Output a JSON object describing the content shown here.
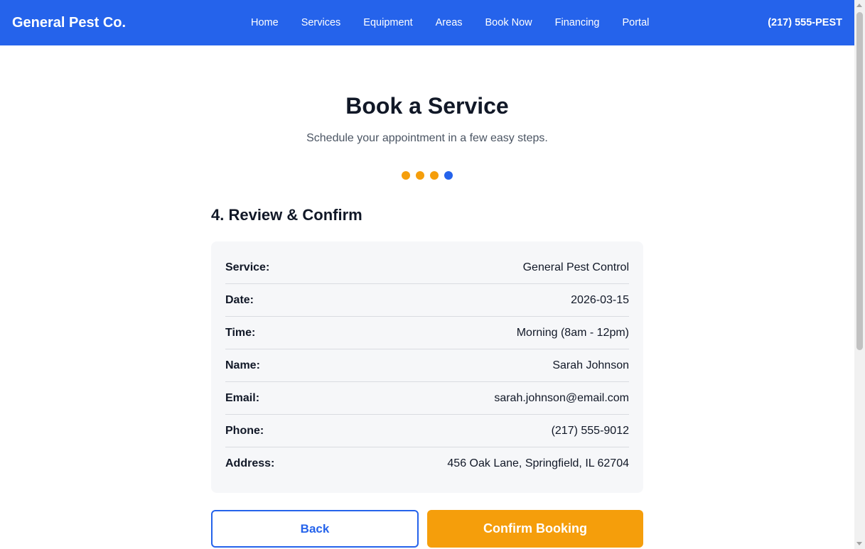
{
  "header": {
    "brand": "General Pest Co.",
    "nav": [
      "Home",
      "Services",
      "Equipment",
      "Areas",
      "Book Now",
      "Financing",
      "Portal"
    ],
    "phone": "(217) 555-PEST"
  },
  "main": {
    "title": "Book a Service",
    "subtitle": "Schedule your appointment in a few easy steps.",
    "progress": {
      "total_steps": 4,
      "current_step": 4
    },
    "step_heading": "4. Review & Confirm",
    "summary": [
      {
        "label": "Service:",
        "value": "General Pest Control"
      },
      {
        "label": "Date:",
        "value": "2026-03-15"
      },
      {
        "label": "Time:",
        "value": "Morning (8am - 12pm)"
      },
      {
        "label": "Name:",
        "value": "Sarah Johnson"
      },
      {
        "label": "Email:",
        "value": "sarah.johnson@email.com"
      },
      {
        "label": "Phone:",
        "value": "(217) 555-9012"
      },
      {
        "label": "Address:",
        "value": "456 Oak Lane, Springfield, IL 62704"
      }
    ],
    "back_label": "Back",
    "confirm_label": "Confirm Booking"
  },
  "colors": {
    "primary": "#2563eb",
    "accent": "#f59e0b",
    "summary_bg": "#f6f7f9"
  }
}
